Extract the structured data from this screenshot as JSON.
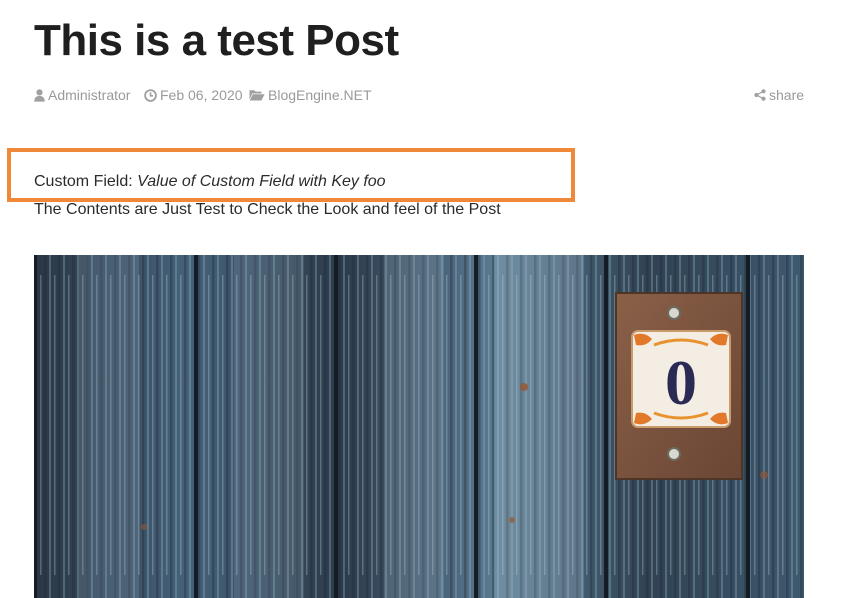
{
  "post": {
    "title": "This is a test Post",
    "author": "Administrator",
    "date": "Feb 06, 2020",
    "category": "BlogEngine.NET",
    "share_label": "share",
    "custom_field_label": "Custom Field:",
    "custom_field_value": "Value of Custom Field with Key foo",
    "body_text": "The Contents are Just Test to Check the Look and feel of the Post",
    "image_sign_text": "0"
  },
  "icons": {
    "author": "user-icon",
    "date": "clock-icon",
    "category": "folder-open-icon",
    "share": "share-icon"
  },
  "colors": {
    "highlight_border": "#f0883a",
    "meta_text": "#9a9a9a",
    "title_text": "#1f1f1f"
  }
}
